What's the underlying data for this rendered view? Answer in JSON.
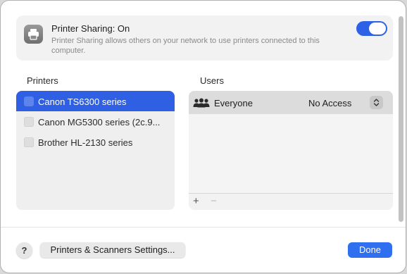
{
  "sharing": {
    "title": "Printer Sharing: On",
    "description": "Printer Sharing allows others on your network to use printers connected to this computer.",
    "enabled": true
  },
  "printers": {
    "label": "Printers",
    "items": [
      {
        "name": "Canon TS6300 series",
        "selected": true
      },
      {
        "name": "Canon MG5300 series (2c.9...",
        "selected": false
      },
      {
        "name": "Brother HL-2130 series",
        "selected": false
      }
    ]
  },
  "users": {
    "label": "Users",
    "rows": [
      {
        "name": "Everyone",
        "access": "No Access"
      }
    ],
    "add_label": "+",
    "remove_label": "−"
  },
  "footer": {
    "help_label": "?",
    "settings_label": "Printers & Scanners Settings...",
    "done_label": "Done"
  },
  "colors": {
    "accent": "#2f6ff0",
    "selection": "#2f5fe2",
    "toggle_on": "#2e62e6"
  },
  "icons": {
    "sharing": "printer-icon",
    "users_row": "group-icon",
    "access_control": "up-down-chevron-icon"
  }
}
